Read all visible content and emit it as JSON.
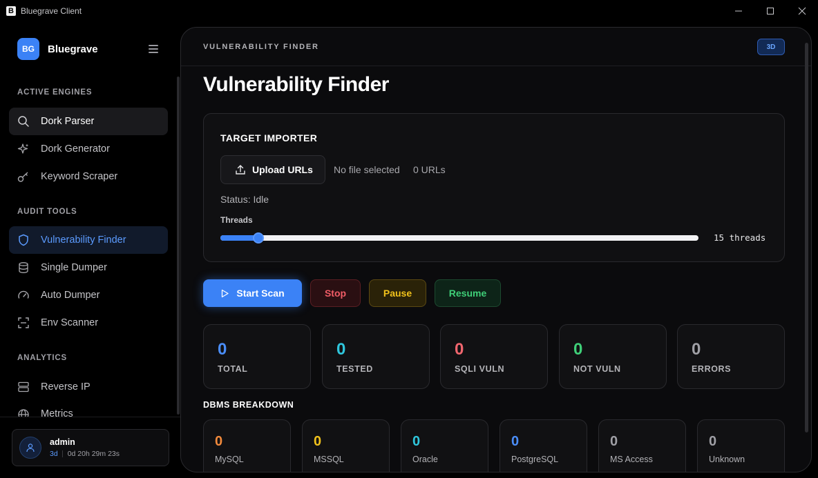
{
  "window": {
    "app_icon_letter": "B",
    "title": "Bluegrave Client",
    "controls": {
      "minimize": "─",
      "maximize": "☐",
      "close": "✕"
    }
  },
  "sidebar": {
    "brand": {
      "logo_text": "BG",
      "name": "Bluegrave"
    },
    "sections": {
      "active_engines": "ACTIVE ENGINES",
      "audit_tools": "AUDIT TOOLS",
      "analytics": "ANALYTICS"
    },
    "items": [
      {
        "label": "Dork Parser",
        "icon": "search-icon"
      },
      {
        "label": "Dork Generator",
        "icon": "sparkles-icon"
      },
      {
        "label": "Keyword Scraper",
        "icon": "key-icon"
      },
      {
        "label": "Vulnerability Finder",
        "icon": "shield-icon"
      },
      {
        "label": "Single Dumper",
        "icon": "database-icon"
      },
      {
        "label": "Auto Dumper",
        "icon": "gauge-icon"
      },
      {
        "label": "Env Scanner",
        "icon": "scan-icon"
      },
      {
        "label": "Reverse IP",
        "icon": "server-icon"
      },
      {
        "label": "Metrics",
        "icon": "globe-icon"
      }
    ],
    "user": {
      "name": "admin",
      "license": "3d",
      "remaining": "0d 20h 29m 23s"
    }
  },
  "main": {
    "topbar_title": "VULNERABILITY FINDER",
    "badge": "3D",
    "page_title": "Vulnerability Finder",
    "importer": {
      "title": "TARGET IMPORTER",
      "upload_label": "Upload URLs",
      "file_status": "No file selected",
      "url_count": "0 URLs",
      "status": "Status: Idle",
      "threads_label": "Threads",
      "threads_value_text": "15 threads",
      "slider_fraction": 0.08
    },
    "actions": {
      "start": "Start Scan",
      "stop": "Stop",
      "pause": "Pause",
      "resume": "Resume"
    },
    "stats": [
      {
        "value": "0",
        "label": "TOTAL",
        "color": "#4a8df8"
      },
      {
        "value": "0",
        "label": "TESTED",
        "color": "#2fc6dc"
      },
      {
        "value": "0",
        "label": "SQLI VULN",
        "color": "#f0666e"
      },
      {
        "value": "0",
        "label": "NOT VULN",
        "color": "#3fcf78"
      },
      {
        "value": "0",
        "label": "ERRORS",
        "color": "#a0a0a6"
      }
    ],
    "dbms_title": "DBMS BREAKDOWN",
    "dbms": [
      {
        "value": "0",
        "label": "MySQL",
        "color": "#f28a3c"
      },
      {
        "value": "0",
        "label": "MSSQL",
        "color": "#f1c21b"
      },
      {
        "value": "0",
        "label": "Oracle",
        "color": "#2fc6dc"
      },
      {
        "value": "0",
        "label": "PostgreSQL",
        "color": "#4a8df8"
      },
      {
        "value": "0",
        "label": "MS Access",
        "color": "#a0a0a6"
      },
      {
        "value": "0",
        "label": "Unknown",
        "color": "#a0a0a6"
      }
    ]
  }
}
